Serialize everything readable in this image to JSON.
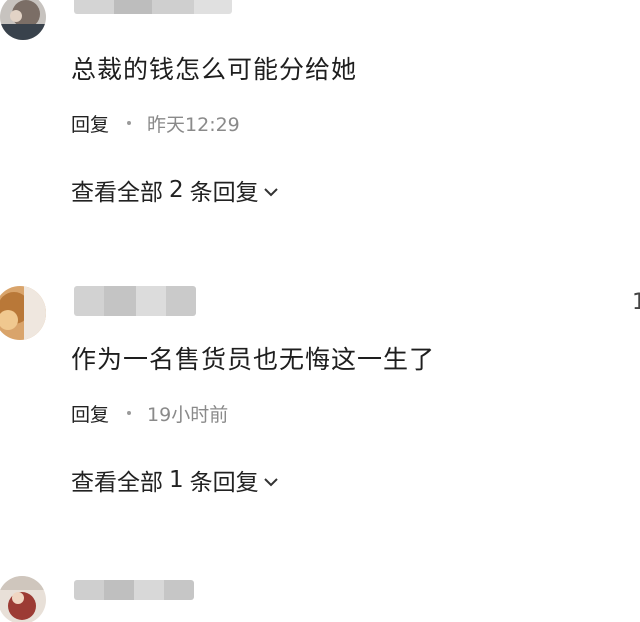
{
  "comments": [
    {
      "text": "总裁的钱怎么可能分给她",
      "reply_label": "回复",
      "time": "昨天12:29",
      "view_all_prefix": "查看全部",
      "reply_count": "2",
      "view_all_suffix": "条回复"
    },
    {
      "text": "作为一名售货员也无悔这一生了",
      "reply_label": "回复",
      "time": "19小时前",
      "view_all_prefix": "查看全部",
      "reply_count": "1",
      "view_all_suffix": "条回复",
      "like_count": "1"
    }
  ],
  "icons": {
    "chevron": "chevron-down-icon"
  },
  "colors": {
    "text_primary": "#1e1e1e",
    "text_secondary": "#8a8a8a",
    "background": "#ffffff"
  }
}
